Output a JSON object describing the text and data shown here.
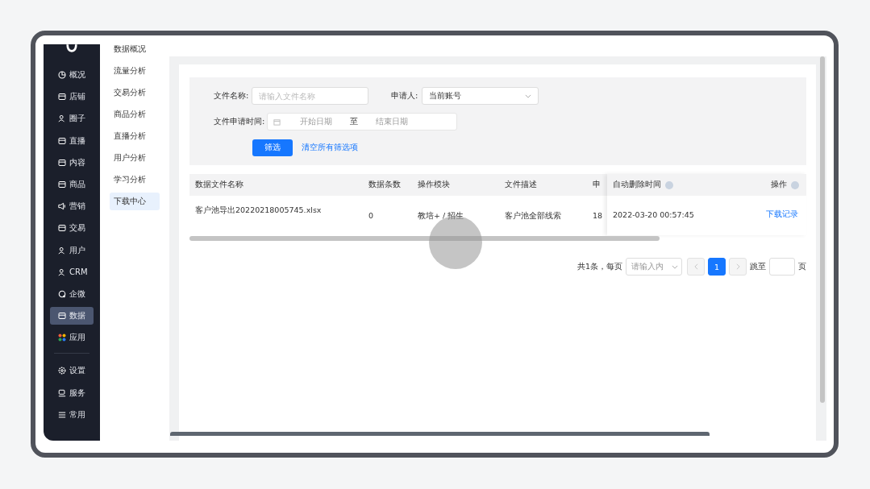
{
  "sidebar": {
    "items": [
      {
        "label": "概况",
        "selected": false
      },
      {
        "label": "店铺",
        "selected": false
      },
      {
        "label": "圈子",
        "selected": false
      },
      {
        "label": "直播",
        "selected": false
      },
      {
        "label": "内容",
        "selected": false
      },
      {
        "label": "商品",
        "selected": false
      },
      {
        "label": "营销",
        "selected": false
      },
      {
        "label": "交易",
        "selected": false
      },
      {
        "label": "用户",
        "selected": false
      },
      {
        "label": "CRM",
        "selected": false
      },
      {
        "label": "企微",
        "selected": false
      },
      {
        "label": "数据",
        "selected": true
      },
      {
        "label": "应用",
        "selected": false
      }
    ],
    "bottom_items": [
      "设置",
      "服务",
      "常用"
    ]
  },
  "subnav": {
    "items": [
      {
        "label": "数据概况",
        "selected": false
      },
      {
        "label": "流量分析",
        "selected": false
      },
      {
        "label": "交易分析",
        "selected": false
      },
      {
        "label": "商品分析",
        "selected": false
      },
      {
        "label": "直播分析",
        "selected": false
      },
      {
        "label": "用户分析",
        "selected": false
      },
      {
        "label": "学习分析",
        "selected": false
      },
      {
        "label": "下载中心",
        "selected": true
      }
    ]
  },
  "filters": {
    "file_name": {
      "label": "文件名称:",
      "placeholder": "请输入文件名称"
    },
    "applicant": {
      "label": "申请人:",
      "value": "当前账号"
    },
    "date_range": {
      "label": "文件申请时间:",
      "start_placeholder": "开始日期",
      "separator": "至",
      "end_placeholder": "结束日期"
    },
    "submit": "筛选",
    "clear": "清空所有筛选项"
  },
  "table": {
    "columns": [
      "数据文件名称",
      "数据条数",
      "操作模块",
      "文件描述",
      "申"
    ],
    "fixed_columns": [
      "自动删除时间",
      "操作"
    ],
    "rows": [
      {
        "cells": [
          "客户池导出20220218005745.xlsx",
          "0",
          "教培+ / 招生",
          "客户池全部线索",
          "18"
        ],
        "fixed": [
          "2022-03-20 00:57:45",
          "下载记录"
        ]
      }
    ]
  },
  "pagination": {
    "total": "共1条，每页",
    "page_size_placeholder": "请输入内",
    "pages": [
      {
        "label": "1",
        "selected": true
      }
    ],
    "jump_label": "跳至",
    "page_suffix": "页"
  }
}
